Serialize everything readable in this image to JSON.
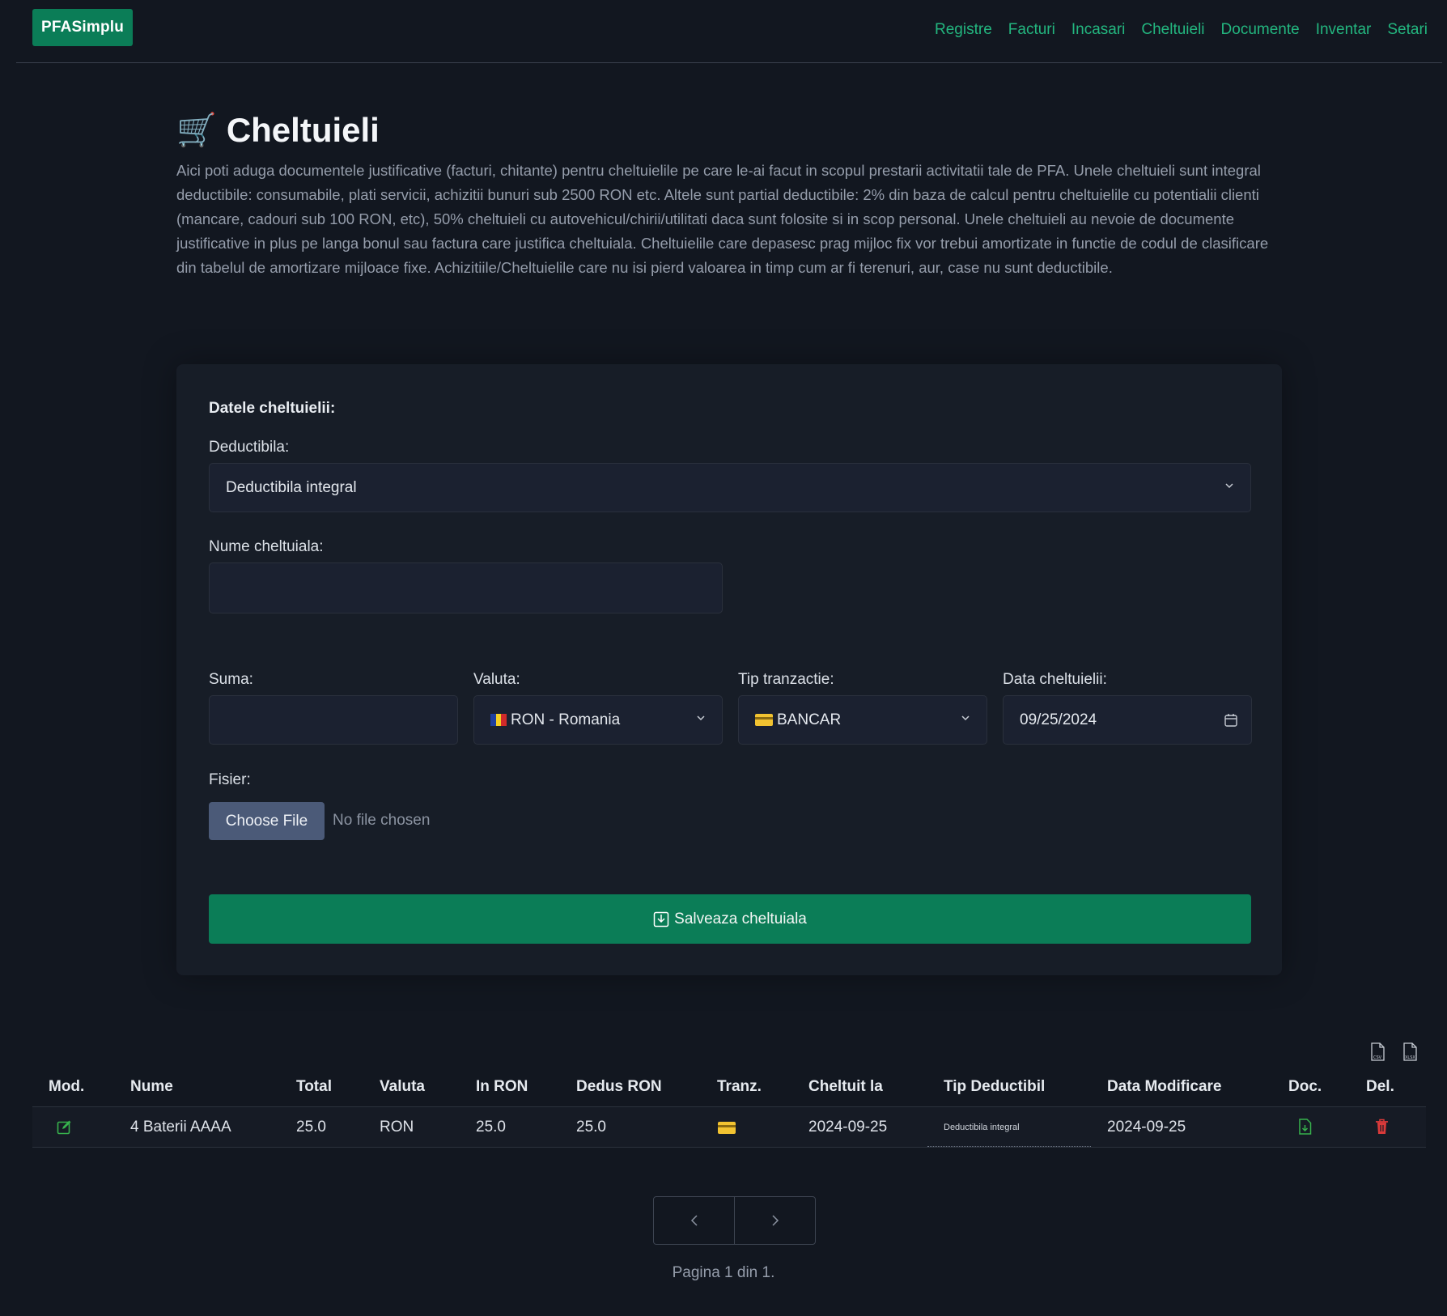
{
  "brand": "PFASimplu",
  "nav": [
    "Registre",
    "Facturi",
    "Incasari",
    "Cheltuieli",
    "Documente",
    "Inventar",
    "Setari"
  ],
  "header": {
    "title": "Cheltuieli",
    "description": "Aici poti aduga documentele justificative (facturi, chitante) pentru cheltuielile pe care le-ai facut in scopul prestarii activitatii tale de PFA. Unele cheltuieli sunt integral deductibile: consumabile, plati servicii, achizitii bunuri sub 2500 RON etc. Altele sunt partial deductibile: 2% din baza de calcul pentru cheltuielile cu potentialii clienti (mancare, cadouri sub 100 RON, etc), 50% cheltuieli cu autovehicul/chirii/utilitati daca sunt folosite si in scop personal. Unele cheltuieli au nevoie de documente justificative in plus pe langa bonul sau factura care justifica cheltuiala. Cheltuielile care depasesc prag mijloc fix vor trebui amortizate in functie de codul de clasificare din tabelul de amortizare mijloace fixe. Achizitiile/Cheltuielile care nu isi pierd valoarea in timp cum ar fi terenuri, aur, case nu sunt deductibile."
  },
  "form": {
    "section_title": "Datele cheltuielii:",
    "deductibila_label": "Deductibila:",
    "deductibila_value": "Deductibila integral",
    "nume_label": "Nume cheltuiala:",
    "nume_value": "",
    "suma_label": "Suma:",
    "suma_value": "",
    "valuta_label": "Valuta:",
    "valuta_value": "RON - Romania",
    "tip_label": "Tip tranzactie:",
    "tip_value": "BANCAR",
    "data_label": "Data cheltuielii:",
    "data_value": "09/25/2024",
    "fisier_label": "Fisier:",
    "file_button": "Choose File",
    "file_status": "No file chosen",
    "save_button": "Salveaza cheltuiala"
  },
  "table": {
    "headers": [
      "Mod.",
      "Nume",
      "Total",
      "Valuta",
      "In RON",
      "Dedus RON",
      "Tranz.",
      "Cheltuit la",
      "Tip Deductibil",
      "Data Modificare",
      "Doc.",
      "Del."
    ],
    "rows": [
      {
        "nume": "4 Baterii AAAA",
        "total": "25.0",
        "valuta": "RON",
        "in_ron": "25.0",
        "dedus_ron": "25.0",
        "cheltuit_la": "2024-09-25",
        "tip_deductibil": "Deductibila integral",
        "data_modificare": "2024-09-25"
      }
    ]
  },
  "pagination": {
    "info": "Pagina 1 din 1."
  },
  "colors": {
    "accent": "#0b7d57",
    "link": "#23b67f",
    "background": "#121720",
    "card": "#171d27"
  }
}
